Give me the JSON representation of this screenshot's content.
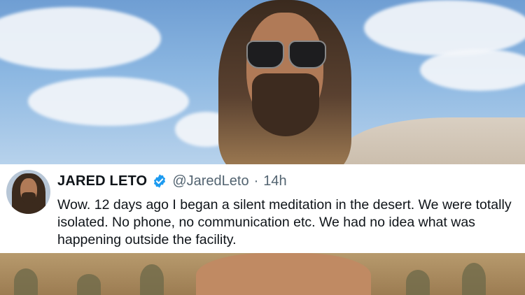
{
  "tweet": {
    "display_name": "JARED LETO",
    "handle": "@JaredLeto",
    "separator": "·",
    "time": "14h",
    "text": "Wow. 12 days ago I began a silent meditation in the desert. We were totally isolated. No phone, no communication etc. We had no idea what was happening outside the facility.",
    "verified_color": "#1d9bf0"
  },
  "colors": {
    "text_primary": "#0f1419",
    "text_secondary": "#536471",
    "card_background": "#ffffff"
  }
}
